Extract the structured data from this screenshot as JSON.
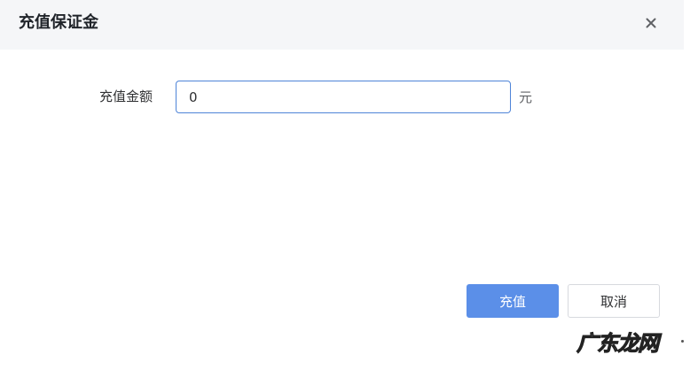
{
  "dialog": {
    "title": "充值保证金",
    "close_icon": "close-icon"
  },
  "form": {
    "amount_label": "充值金额",
    "amount_value": "0",
    "unit": "元"
  },
  "footer": {
    "confirm_label": "充值",
    "cancel_label": "取消"
  },
  "watermark": {
    "text": "广东龙网"
  },
  "colors": {
    "primary": "#5b8fe8",
    "header_bg": "#f5f6f8",
    "input_border": "#4e84d8",
    "button_border": "#d7d9de"
  }
}
